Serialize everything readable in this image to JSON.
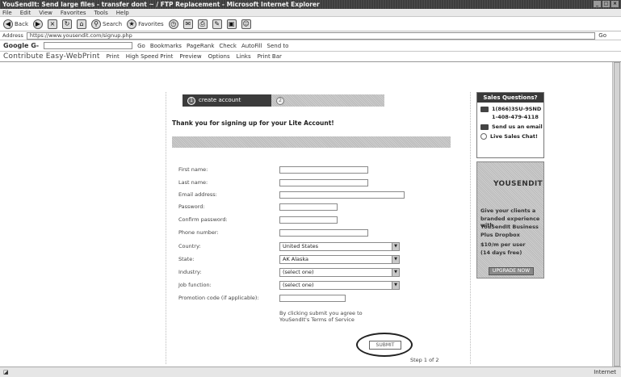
{
  "window": {
    "title": "YouSendIt: Send large files - transfer dont ~ / FTP Replacement - Microsoft Internet Explorer"
  },
  "menu": [
    "File",
    "Edit",
    "View",
    "Favorites",
    "Tools",
    "Help"
  ],
  "toolbar": {
    "back": "Back",
    "search": "Search",
    "favorites": "Favorites"
  },
  "address": {
    "label": "Address",
    "url": "https://www.yousendit.com/signup.php",
    "go": "Go"
  },
  "googlebar": {
    "logo": "Google G-",
    "go": "Go",
    "bookmarks": "Bookmarks",
    "pagerank": "PageRank",
    "check": "Check",
    "autofill": "AutoFill",
    "sendto": "Send to"
  },
  "linksbar": {
    "title": "Contribute Easy-WebPrint",
    "print": "Print",
    "high_speed_print": "High Speed Print",
    "preview": "Preview",
    "options": "Options",
    "links": "Links",
    "print_bar": "Print Bar"
  },
  "steps": {
    "step1_num": "1",
    "step1_label": "create account",
    "step2_num": "2",
    "step2_label": ""
  },
  "signup": {
    "thanks": "Thank you for signing up for your Lite Account!",
    "fields": {
      "first_name": "First name:",
      "last_name": "Last name:",
      "email": "Email address:",
      "password": "Password:",
      "confirm_password": "Confirm password:",
      "phone": "Phone number:",
      "country": "Country:",
      "state": "State:",
      "industry": "Industry:",
      "job_function": "Job function:",
      "promo_code": "Promotion code (if applicable):"
    },
    "selects": {
      "country": "United States",
      "state": "AK Alaska",
      "industry": "(select one)",
      "job_function": "(select one)"
    },
    "terms_line1": "By clicking submit you agree to",
    "terms_line2": "YouSendIt's Terms of Service",
    "submit": "SUBMIT",
    "step_of": "Step 1 of 2"
  },
  "sales": {
    "header": "Sales Questions?",
    "phone1": "1(866)3SU-9SND",
    "phone2": "1-408-479-4118",
    "email": "Send us an email",
    "chat": "Live Sales Chat!"
  },
  "ad": {
    "logo": "YOUSENDIT",
    "line1": "Give your clients a",
    "line2": "branded experience with",
    "line3": "YouSendIt Business",
    "line4": "Plus Dropbox",
    "line5": "$10/m per user",
    "line6": "(14 days free)",
    "upgrade": "UPGRADE NOW"
  },
  "status": {
    "zone": "Internet"
  }
}
